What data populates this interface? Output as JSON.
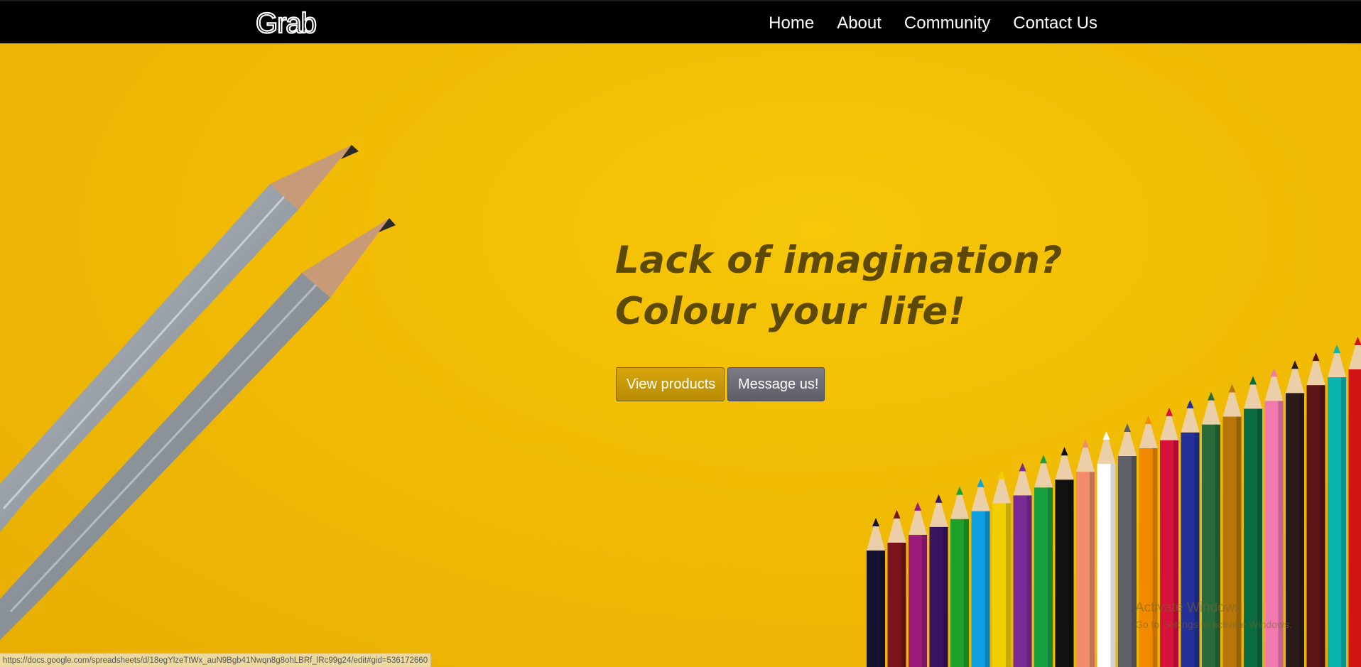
{
  "brand": {
    "logo_text": "Grab"
  },
  "nav": {
    "items": [
      {
        "label": "Home"
      },
      {
        "label": "About"
      },
      {
        "label": "Community"
      },
      {
        "label": "Contact Us"
      }
    ]
  },
  "hero": {
    "headline_line1": "Lack of imagination?",
    "headline_line2": "Colour your life!",
    "products_button": "View products",
    "message_button": "Message us!",
    "background_color": "#f5c000",
    "pencil_colors": [
      "#141432",
      "#7a1418",
      "#9c1c7c",
      "#3a1460",
      "#1ea02a",
      "#0ea0e0",
      "#f2cf00",
      "#7a2a94",
      "#18a040",
      "#111111",
      "#f28c6c",
      "#ffffff",
      "#5f5f66",
      "#f28a00",
      "#d4123a",
      "#24309a",
      "#2a6a3a",
      "#b8760a",
      "#0a6a40",
      "#f07ab0",
      "#2a1a1a",
      "#5c1418",
      "#0ab4b0",
      "#d21414"
    ]
  },
  "watermark": {
    "title": "Activate Windows",
    "subtitle": "Go to Settings to activate Windows."
  },
  "status_bar": {
    "url": "https://docs.google.com/spreadsheets/d/18egYlzeTtWx_auN9Bgb41Nwqn8g8ohLBRf_lRc99g24/edit#gid=536172660"
  }
}
